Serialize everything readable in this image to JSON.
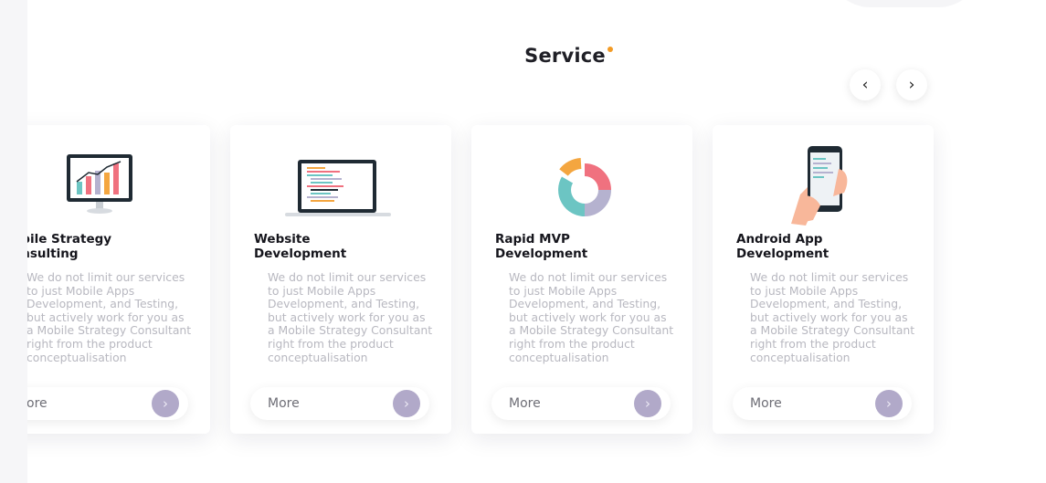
{
  "section": {
    "title": "Service"
  },
  "nav": {
    "prev_icon": "‹",
    "next_icon": "›"
  },
  "services": [
    {
      "title_line1": "obile Strategy",
      "title_line2": "onsulting",
      "description": "We do not limit our services to just Mobile Apps Development, and Testing, but actively work for you as a Mobile Strategy Consultant right from the product conceptualisation",
      "more_label": "ore",
      "icon": "monitor-chart-icon"
    },
    {
      "title_line1": "Website",
      "title_line2": "Development",
      "description": "We do not limit our services to just Mobile Apps Development, and Testing, but actively work for you as a Mobile Strategy Consultant right from the product conceptualisation",
      "more_label": "More",
      "icon": "laptop-code-icon"
    },
    {
      "title_line1": "Rapid MVP",
      "title_line2": "Development",
      "description": "We do not limit our services to just Mobile Apps Development, and Testing, but actively work for you as a Mobile Strategy Consultant right from the product conceptualisation",
      "more_label": "More",
      "icon": "donut-chart-icon"
    },
    {
      "title_line1": "Android App",
      "title_line2": "Development",
      "description": "We do not limit our services to just Mobile Apps Development, and Testing, but actively work for you as a Mobile Strategy Consultant right from the product conceptualisation",
      "more_label": "More",
      "icon": "hand-phone-icon"
    }
  ],
  "colors": {
    "accent_dot": "#f39b25",
    "more_arrow": "#b1a9c9",
    "chart_red": "#f0717f",
    "chart_teal": "#6cc5c3",
    "chart_orange": "#f4a640",
    "chart_lavender": "#b5b2cf"
  }
}
